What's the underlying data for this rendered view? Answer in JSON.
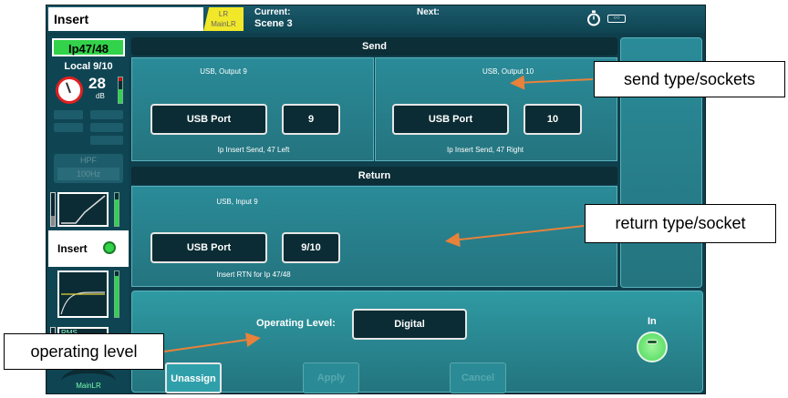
{
  "header": {
    "screen_title": "Insert",
    "mix_tag_line1": "LR",
    "mix_tag_line2": "MainLR",
    "current_label": "Current:",
    "current_value": "Scene 3",
    "next_label": "Next:"
  },
  "strip": {
    "channel_name": "Ip47/48",
    "source": "Local 9/10",
    "gain_value": "28",
    "gain_unit": "dB",
    "gain_meter_level": 0.55,
    "hpf_label": "HPF",
    "hpf_value": "100Hz",
    "insert_label": "Insert",
    "rms_label": "RMS",
    "mix_label": "MainLR"
  },
  "send": {
    "title": "Send",
    "left": {
      "caption_top": "USB, Output 9",
      "type_value": "USB Port",
      "socket_value": "9",
      "caption_bottom": "Ip Insert Send, 47 Left"
    },
    "right": {
      "caption_top": "USB, Output 10",
      "type_value": "USB Port",
      "socket_value": "10",
      "caption_bottom": "Ip Insert Send, 47 Right"
    }
  },
  "return": {
    "title": "Return",
    "caption_top": "USB, Input 9",
    "type_value": "USB Port",
    "socket_value": "9/10",
    "caption_bottom": "Insert RTN for Ip 47/48"
  },
  "bottom": {
    "operating_level_label": "Operating Level:",
    "operating_level_value": "Digital",
    "in_label": "In",
    "unassign_label": "Unassign",
    "apply_label": "Apply",
    "cancel_label": "Cancel"
  },
  "callouts": {
    "send": "send type/sockets",
    "return": "return type/socket",
    "operating": "operating level"
  },
  "colors": {
    "accent_green": "#32d24a",
    "callout_arrow": "#e8823a",
    "panel_teal": "#2a8b98"
  }
}
